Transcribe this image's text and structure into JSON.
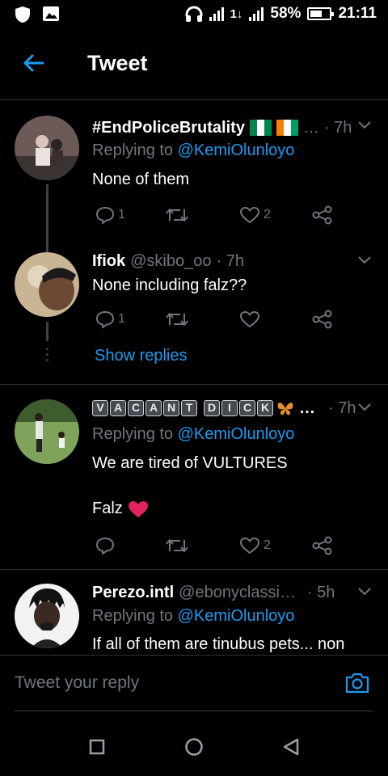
{
  "status_bar": {
    "battery": "58%",
    "time": "21:11",
    "net1": "4G",
    "net2": "1↓",
    "net3": "H+"
  },
  "header": {
    "title": "Tweet"
  },
  "tweets": [
    {
      "name": "#EndPoliceBrutality",
      "name_suffix": "…",
      "time": "· 7h",
      "reply_prefix": "Replying to",
      "reply_to": "@KemiOlunloyo",
      "text": "None of them",
      "replies": "1",
      "retweets": "",
      "likes": "2"
    },
    {
      "name": "Ifiok",
      "handle": "@skibo_oo",
      "time": "· 7h",
      "text": "None including falz??",
      "replies": "1",
      "retweets": "",
      "likes": ""
    },
    {
      "name_letters": [
        "V",
        "A",
        "C",
        "A",
        "N",
        "T",
        "D",
        "I",
        "C",
        "K"
      ],
      "name_suffix": "…",
      "time": "· 7h",
      "reply_prefix": "Replying to",
      "reply_to": "@KemiOlunloyo",
      "text_line1": "We are tired of VULTURES",
      "text_line2": "Falz",
      "replies": "",
      "retweets": "",
      "likes": "2"
    },
    {
      "name": "Perezo.intl",
      "handle": "@ebonyclassi…",
      "time": "· 5h",
      "reply_prefix": "Replying to",
      "reply_to": "@KemiOlunloyo",
      "text": "If all of them are tinubus pets... non"
    }
  ],
  "show_replies": "Show replies",
  "reply_box": {
    "placeholder": "Tweet your reply"
  },
  "colors": {
    "accent": "#1d9bf0",
    "muted": "#6e767d",
    "background": "#000000",
    "divider": "#2f3336",
    "heart_red": "#e0245e"
  },
  "icons": [
    "back-arrow-icon",
    "reply-icon",
    "retweet-icon",
    "like-icon",
    "share-icon",
    "caret-down-icon",
    "camera-icon",
    "square-nav-icon",
    "circle-nav-icon",
    "triangle-nav-icon"
  ]
}
